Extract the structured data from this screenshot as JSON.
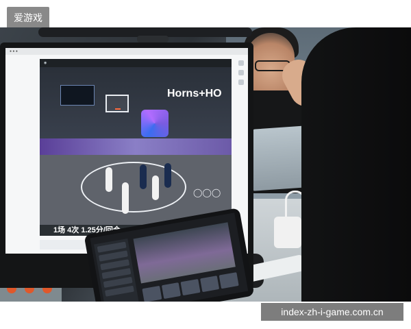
{
  "header": {
    "tag_text": "爱游戏"
  },
  "footer": {
    "watermark_text": "index-zh-i-game.com.cn"
  },
  "screen": {
    "app_title": "Horns+HO",
    "subtitle": "1场 4次 1.25分/回合",
    "rings": "◯◯◯"
  },
  "icons": {
    "scoreboard": "scoreboard-icon",
    "olympic_rings": "olympic-rings-icon"
  }
}
